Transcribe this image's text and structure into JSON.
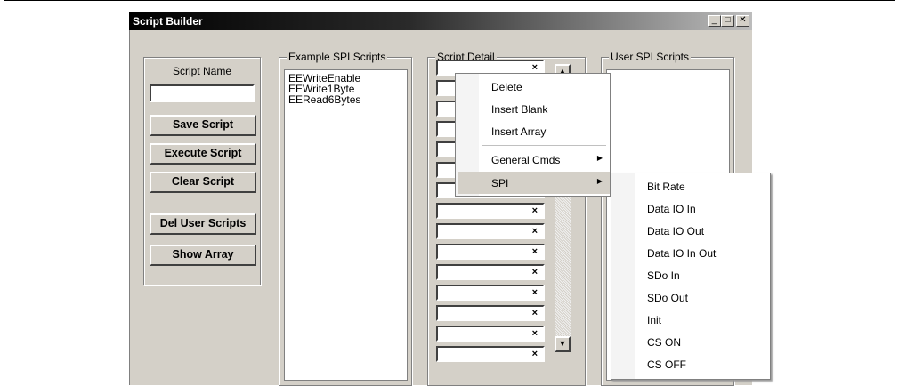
{
  "window": {
    "title": "Script Builder",
    "controls": {
      "minimize": "_",
      "maximize": "□",
      "close": "✕"
    }
  },
  "script_name": {
    "label": "Script Name",
    "value": ""
  },
  "buttons": {
    "save": "Save Script",
    "execute": "Execute Script",
    "clear": "Clear Script",
    "del_user": "Del User Scripts",
    "show_array": "Show Array"
  },
  "example_scripts": {
    "label": "Example SPI Scripts",
    "items": [
      "EEWriteEnable",
      "EEWrite1Byte",
      "EERead6Bytes"
    ]
  },
  "script_detail": {
    "label": "Script Detail",
    "row_delete_glyph": "×"
  },
  "user_scripts": {
    "label": "User SPI Scripts",
    "items": []
  },
  "context_menu": {
    "items": [
      {
        "label": "Delete"
      },
      {
        "label": "Insert Blank"
      },
      {
        "label": "Insert Array"
      },
      {
        "label": "General Cmds",
        "submenu_arrow": "▶"
      },
      {
        "label": "SPI",
        "submenu_arrow": "▶",
        "selected": true
      }
    ]
  },
  "spi_submenu": {
    "items": [
      "Bit Rate",
      "Data IO In",
      "Data IO Out",
      "Data IO In Out",
      "SDo In",
      "SDo Out",
      "Init",
      "CS ON",
      "CS OFF"
    ]
  },
  "colors": {
    "window_bg": "#d4d0c8",
    "titlebar": "#000000",
    "menu_selected": "#d4d0c8"
  }
}
